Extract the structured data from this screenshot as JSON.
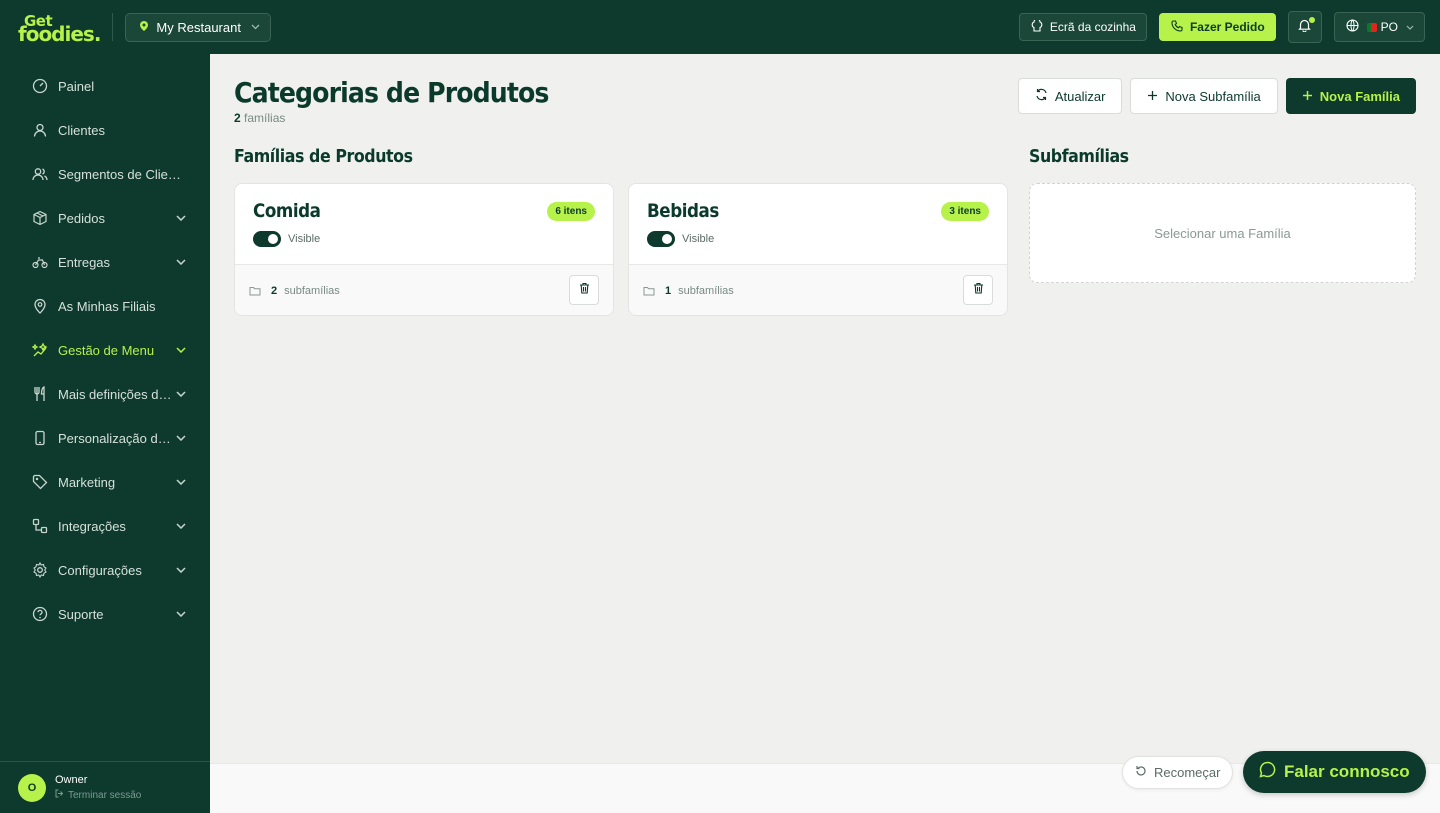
{
  "header": {
    "logo_line1": "Get",
    "logo_line2": "foodies.",
    "restaurant": "My Restaurant",
    "kitchen_label": "Ecrã da cozinha",
    "order_label": "Fazer Pedido",
    "lang_code": "PO"
  },
  "sidebar": {
    "items": [
      {
        "label": "Painel",
        "icon": "dashboard-icon"
      },
      {
        "label": "Clientes",
        "icon": "user-icon"
      },
      {
        "label": "Segmentos de Clientes",
        "icon": "users-icon"
      },
      {
        "label": "Pedidos",
        "icon": "box-icon"
      },
      {
        "label": "Entregas",
        "icon": "bike-icon"
      },
      {
        "label": "As Minhas Filiais",
        "icon": "location-icon"
      },
      {
        "label": "Gestão de Menu",
        "icon": "menu-icon"
      },
      {
        "label": "Mais definições de menu",
        "icon": "utensils-icon"
      },
      {
        "label": "Personalização do app",
        "icon": "phone-icon"
      },
      {
        "label": "Marketing",
        "icon": "tag-icon"
      },
      {
        "label": "Integrações",
        "icon": "integration-icon"
      },
      {
        "label": "Configurações",
        "icon": "gear-icon"
      },
      {
        "label": "Suporte",
        "icon": "help-icon"
      }
    ],
    "user_initial": "O",
    "user_name": "Owner",
    "logout_label": "Terminar sessão"
  },
  "main": {
    "title": "Categorias de Produtos",
    "family_count": "2",
    "family_count_label": "famílias",
    "refresh_label": "Atualizar",
    "new_subfamily_label": "Nova Subfamília",
    "new_family_label": "Nova Família",
    "families_title": "Famílias de Produtos",
    "subfamilies_title": "Subfamílias",
    "families": [
      {
        "name": "Comida",
        "badge": "6 itens",
        "visible_label": "Visible",
        "sub_count": "2",
        "sub_label": "subfamílias"
      },
      {
        "name": "Bebidas",
        "badge": "3 itens",
        "visible_label": "Visible",
        "sub_count": "1",
        "sub_label": "subfamílias"
      }
    ],
    "sub_placeholder": "Selecionar uma Família"
  },
  "footer": {
    "restart_label": "Recomeçar",
    "chat_label": "Falar connosco"
  },
  "colors": {
    "brand_dark": "#0d3a2c",
    "accent": "#b6f24a"
  }
}
